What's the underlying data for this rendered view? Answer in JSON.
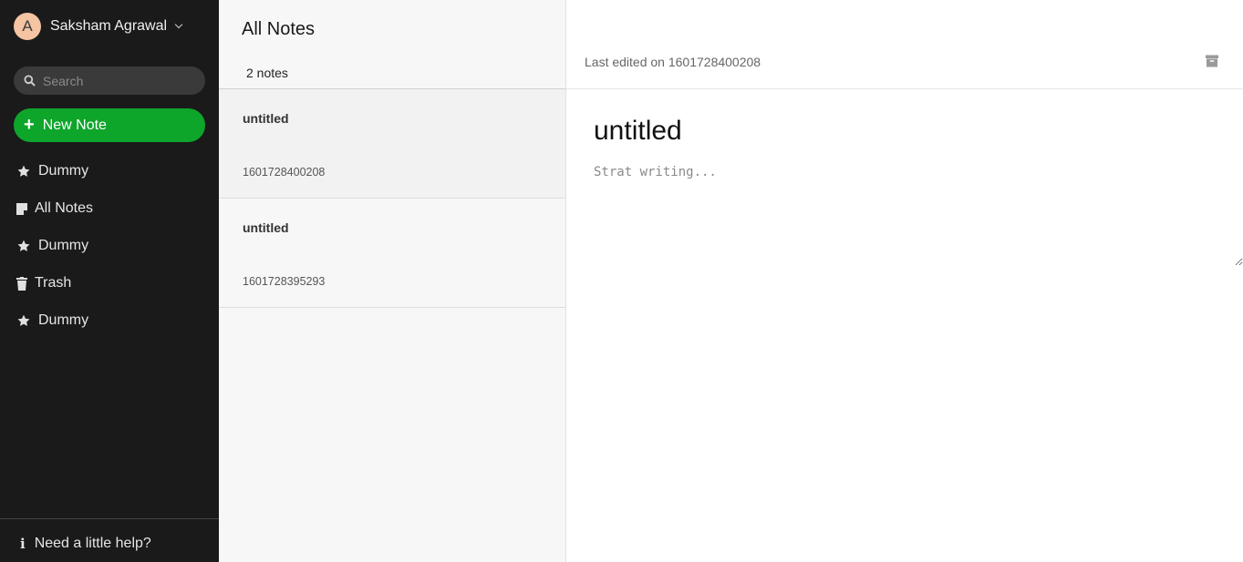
{
  "user": {
    "avatar_letter": "A",
    "name": "Saksham Agrawal"
  },
  "search": {
    "placeholder": "Search"
  },
  "new_note": {
    "label": "New Note"
  },
  "nav": [
    {
      "label": "Dummy",
      "icon": "star-icon"
    },
    {
      "label": "All Notes",
      "icon": "note-icon"
    },
    {
      "label": "Dummy",
      "icon": "star-icon"
    },
    {
      "label": "Trash",
      "icon": "trash-icon"
    },
    {
      "label": "Dummy",
      "icon": "star-icon"
    }
  ],
  "help": {
    "label": "Need a little help?",
    "icon": "info-icon"
  },
  "notes_list": {
    "title": "All Notes",
    "count": "2 notes",
    "items": [
      {
        "title": "untitled",
        "date": "1601728400208"
      },
      {
        "title": "untitled",
        "date": "1601728395293"
      }
    ]
  },
  "editor": {
    "last_edited": "Last edited on 1601728400208",
    "title": "untitled",
    "body_placeholder": "Strat writing...",
    "archive_icon": "archive-icon"
  },
  "colors": {
    "sidebar_bg": "#1a1a1a",
    "accent_green": "#0ea52b",
    "avatar_bg": "#f5c4a3",
    "list_bg": "#f7f7f7"
  }
}
